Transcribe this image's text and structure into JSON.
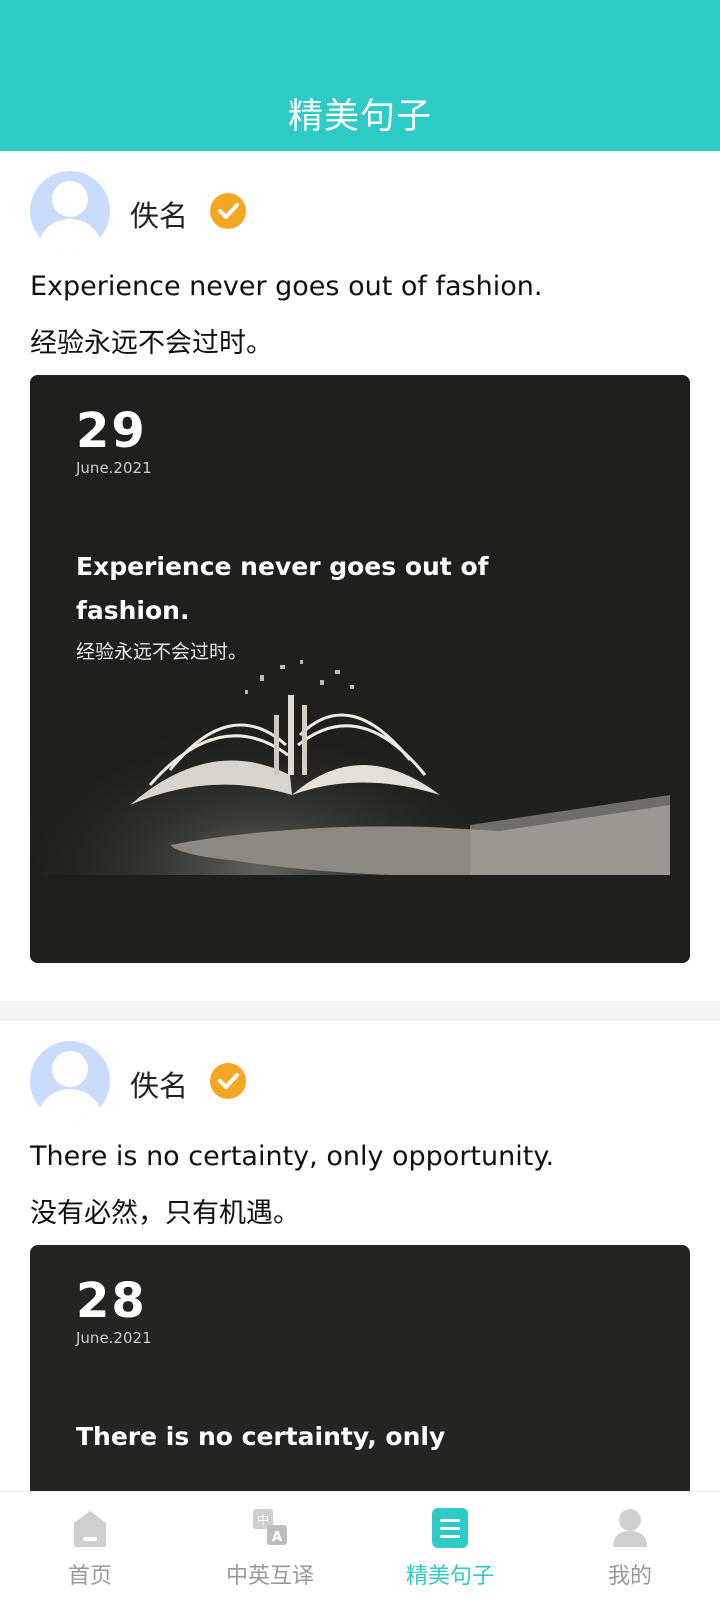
{
  "header": {
    "title": "精美句子"
  },
  "posts": [
    {
      "author": "佚名",
      "quote_en": "Experience never goes out of fashion.",
      "quote_zh": "经验永远不会过时。",
      "card": {
        "day": "29",
        "month": "June.2021",
        "text_en": "Experience never goes out of fashion.",
        "text_zh": "经验永远不会过时。"
      }
    },
    {
      "author": "佚名",
      "quote_en": "There is no certainty, only opportunity.",
      "quote_zh": "没有必然，只有机遇。",
      "card": {
        "day": "28",
        "month": "June.2021",
        "text_en": "There is no certainty, only"
      }
    }
  ],
  "tabs": [
    {
      "label": "首页",
      "icon": "home-icon",
      "active": false
    },
    {
      "label": "中英互译",
      "icon": "translate-icon",
      "active": false
    },
    {
      "label": "精美句子",
      "icon": "sentence-icon",
      "active": true
    },
    {
      "label": "我的",
      "icon": "profile-icon",
      "active": false
    }
  ],
  "colors": {
    "accent": "#2ecac6",
    "verified": "#f5a623",
    "avatar": "#c9dcfb",
    "card_bg": "#201f1c",
    "inactive": "#999999"
  }
}
